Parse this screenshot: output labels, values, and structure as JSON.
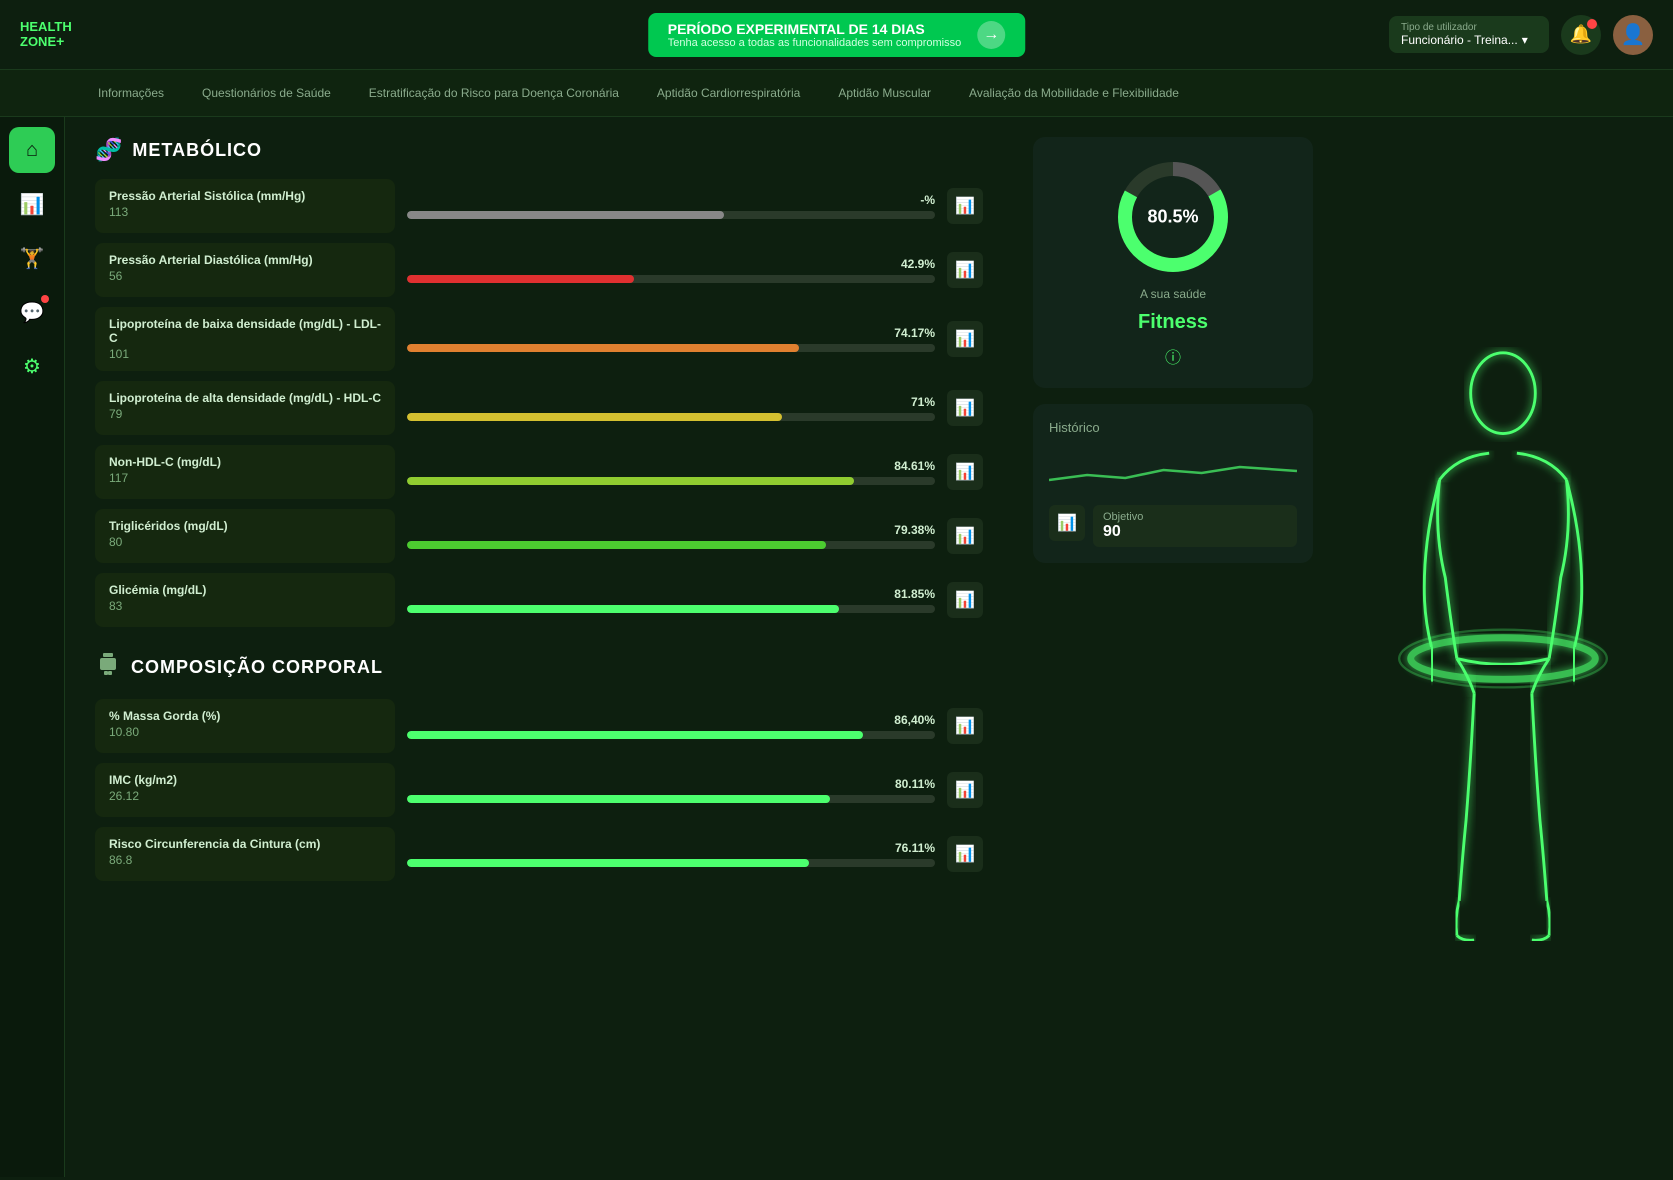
{
  "logo": {
    "line1": "HEALTH",
    "line2": "ZONE",
    "dot": "+"
  },
  "promo": {
    "title": "PERÍODO EXPERIMENTAL DE 14 DIAS",
    "subtitle": "Tenha acesso a todas as funcionalidades sem compromisso",
    "arrow": "→"
  },
  "header": {
    "user_type_label": "Tipo de utilizador",
    "user_type_value": "Funcionário - Treina...",
    "chevron": "▾"
  },
  "nav_tabs": [
    {
      "id": "informacoes",
      "label": "Informações"
    },
    {
      "id": "questionarios",
      "label": "Questionários de Saúde"
    },
    {
      "id": "estratificacao",
      "label": "Estratificação do Risco para Doença Coronária"
    },
    {
      "id": "aptidao-cardio",
      "label": "Aptidão Cardiorrespiratória"
    },
    {
      "id": "aptidao-muscular",
      "label": "Aptidão Muscular"
    },
    {
      "id": "avaliacao-mobilidade",
      "label": "Avaliação da Mobilidade e Flexibilidade"
    }
  ],
  "sidebar": {
    "items": [
      {
        "id": "home",
        "icon": "⌂",
        "active": true
      },
      {
        "id": "chart",
        "icon": "📊",
        "active": false
      },
      {
        "id": "dumbbell",
        "icon": "🏋",
        "active": false
      },
      {
        "id": "message",
        "icon": "💬",
        "active": false,
        "badge": true
      },
      {
        "id": "settings",
        "icon": "⚙",
        "active": false
      }
    ]
  },
  "sections": {
    "metabolico": {
      "icon": "🧬",
      "title": "METABÓLICO",
      "metrics": [
        {
          "name": "Pressão Arterial Sistólica (mm/Hg)",
          "value": "113",
          "percent": "-%",
          "fill_pct": 60,
          "color": "#888"
        },
        {
          "name": "Pressão Arterial Diastólica (mm/Hg)",
          "value": "56",
          "percent": "42.9%",
          "fill_pct": 42.9,
          "color": "#e03030"
        },
        {
          "name": "Lipoproteína de baixa densidade (mg/dL) - LDL-C",
          "value": "101",
          "percent": "74.17%",
          "fill_pct": 74.17,
          "color": "#e08030"
        },
        {
          "name": "Lipoproteína de alta densidade (mg/dL) - HDL-C",
          "value": "79",
          "percent": "71%",
          "fill_pct": 71,
          "color": "#d4c030"
        },
        {
          "name": "Non-HDL-C (mg/dL)",
          "value": "117",
          "percent": "84.61%",
          "fill_pct": 84.61,
          "color": "#90cc30"
        },
        {
          "name": "Triglicéridos (mg/dL)",
          "value": "80",
          "percent": "79.38%",
          "fill_pct": 79.38,
          "color": "#4ccc30"
        },
        {
          "name": "Glicémia (mg/dL)",
          "value": "83",
          "percent": "81.85%",
          "fill_pct": 81.85,
          "color": "#4cff6e"
        }
      ]
    },
    "composicao": {
      "icon": "⬡",
      "title": "COMPOSIÇÃO CORPORAL",
      "metrics": [
        {
          "name": "% Massa Gorda (%)",
          "value": "10.80",
          "percent": "86,40%",
          "fill_pct": 86.4,
          "color": "#4cff6e"
        },
        {
          "name": "IMC (kg/m2)",
          "value": "26.12",
          "percent": "80.11%",
          "fill_pct": 80.11,
          "color": "#4cff6e"
        },
        {
          "name": "Risco Circunferencia da Cintura (cm)",
          "value": "86.8",
          "percent": "76.11%",
          "fill_pct": 76.11,
          "color": "#4cff6e"
        }
      ]
    }
  },
  "health_score": {
    "percent": "80.5%",
    "label": "A sua saúde",
    "status": "Fitness",
    "donut_bg": "#2a3a2a",
    "donut_green": "#4cff6e",
    "donut_gray": "#555"
  },
  "historico": {
    "title": "Histórico",
    "objetivo_label": "Objetivo",
    "objetivo_value": "90"
  }
}
